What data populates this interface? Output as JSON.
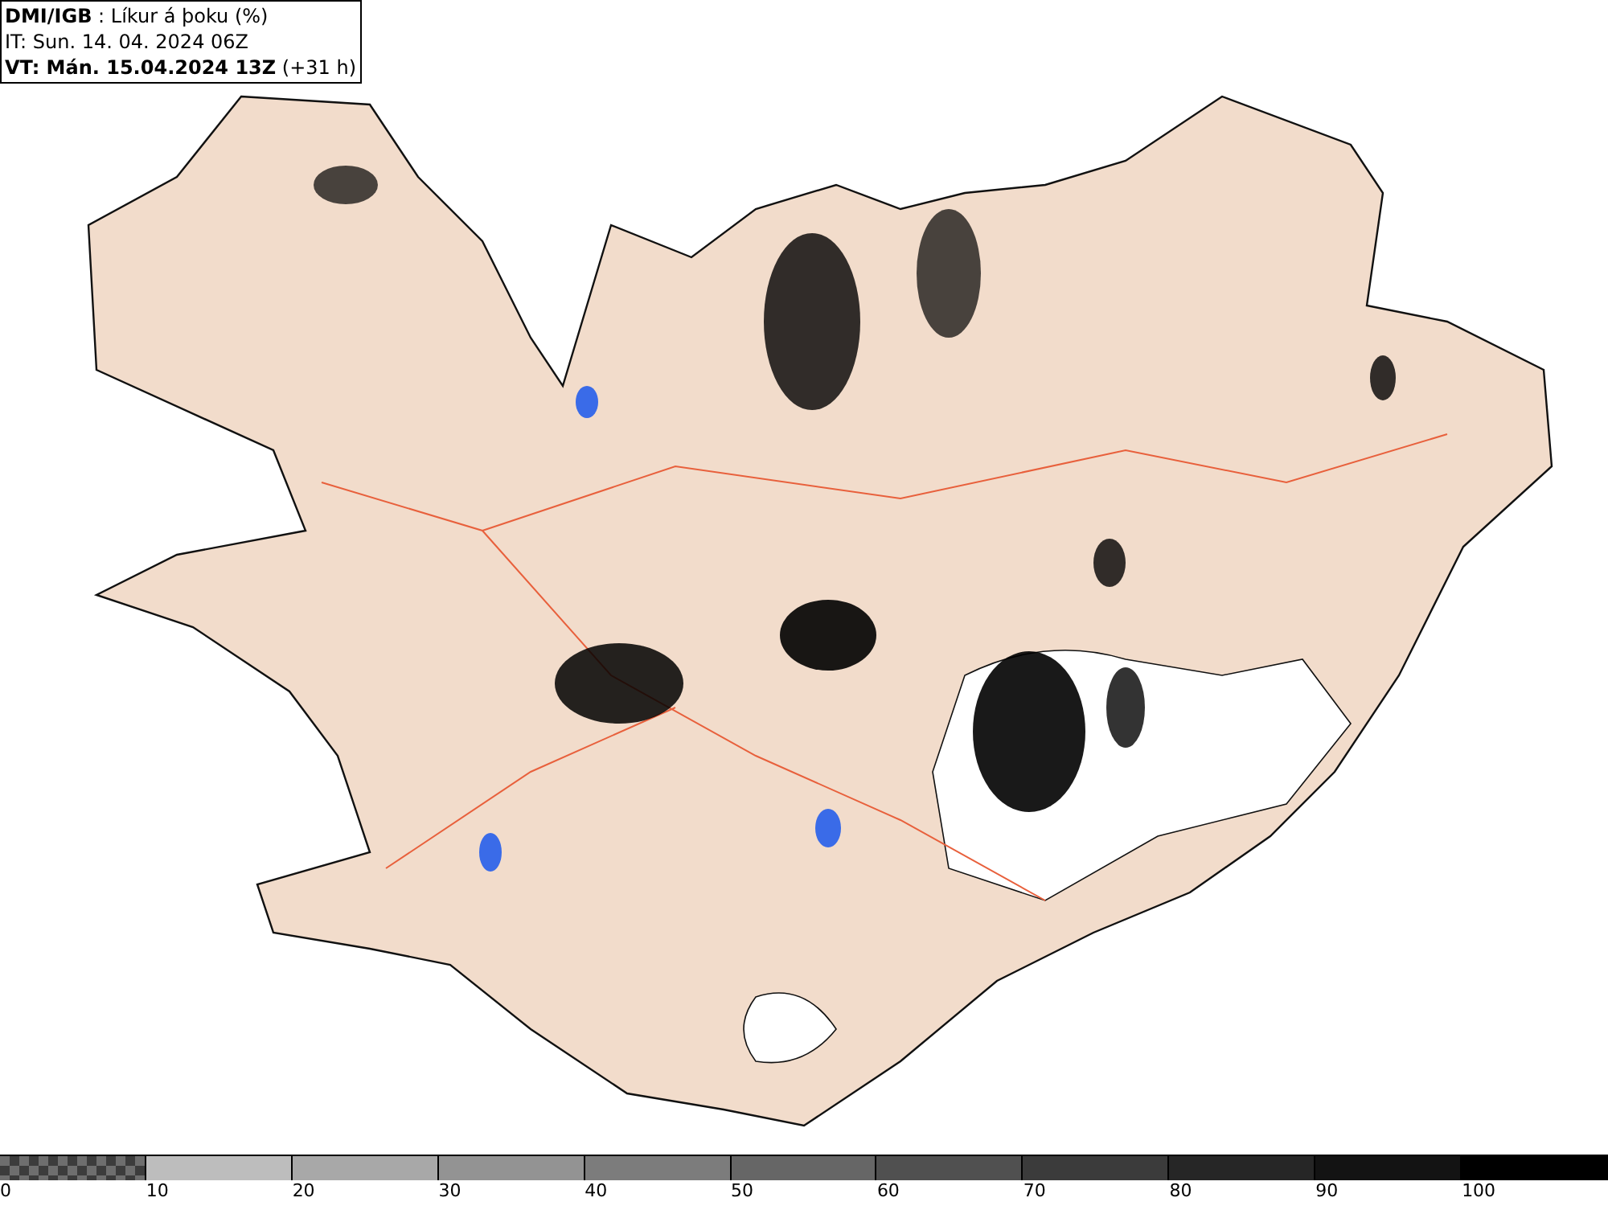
{
  "header": {
    "lines": [
      "**DMI/IGB** : Líkur á þoku (%)",
      "IT: Sun. 14. 04. 2024 06Z",
      "**VT: Mán. 15.04.2024 13Z** (+31 h)"
    ]
  },
  "legend": {
    "bins": [
      {
        "label": "0",
        "kind": "checker",
        "color": "#6e6e6e"
      },
      {
        "label": "10",
        "kind": "solid",
        "color": "#bdbdbd"
      },
      {
        "label": "20",
        "kind": "solid",
        "color": "#a8a8a8"
      },
      {
        "label": "30",
        "kind": "solid",
        "color": "#939393"
      },
      {
        "label": "40",
        "kind": "solid",
        "color": "#7c7c7c"
      },
      {
        "label": "50",
        "kind": "solid",
        "color": "#666666"
      },
      {
        "label": "60",
        "kind": "solid",
        "color": "#505050"
      },
      {
        "label": "70",
        "kind": "solid",
        "color": "#3b3b3b"
      },
      {
        "label": "80",
        "kind": "solid",
        "color": "#262626"
      },
      {
        "label": "90",
        "kind": "solid",
        "color": "#131313"
      },
      {
        "label": "100",
        "kind": "solid",
        "color": "#000000"
      }
    ]
  }
}
